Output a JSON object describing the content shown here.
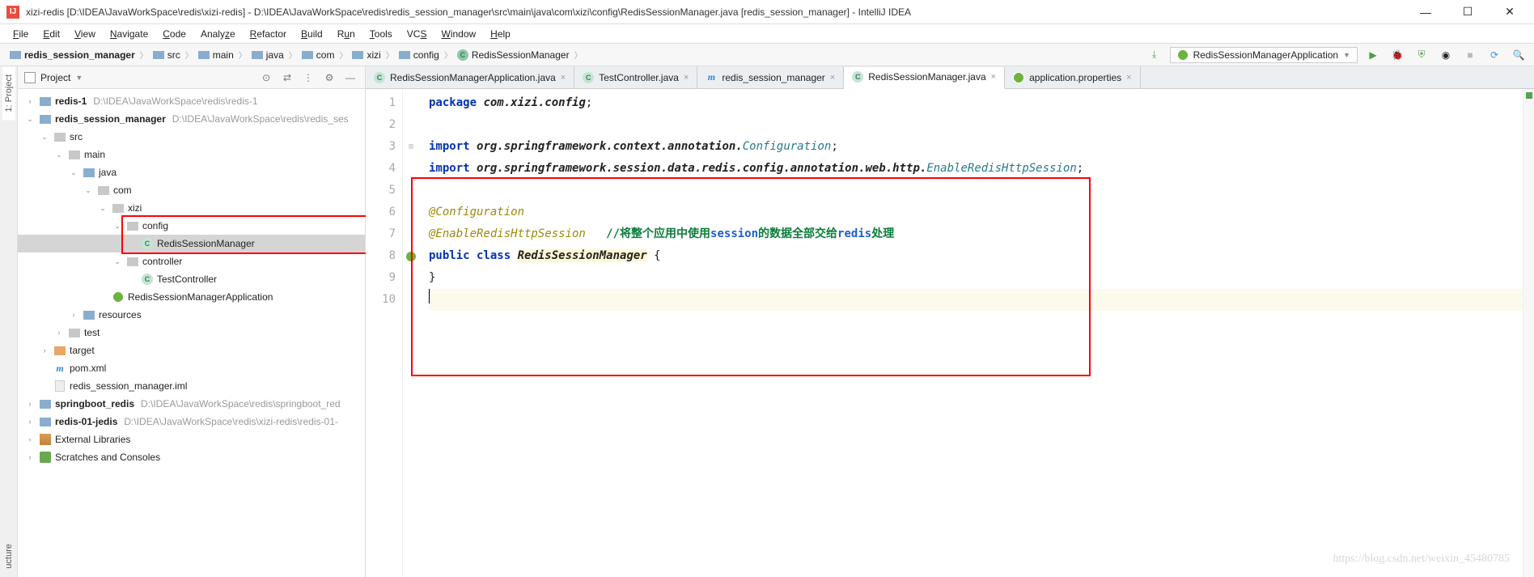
{
  "window": {
    "title": "xizi-redis [D:\\IDEA\\JavaWorkSpace\\redis\\xizi-redis] - D:\\IDEA\\JavaWorkSpace\\redis\\redis_session_manager\\src\\main\\java\\com\\xizi\\config\\RedisSessionManager.java [redis_session_manager] - IntelliJ IDEA"
  },
  "menu": [
    "File",
    "Edit",
    "View",
    "Navigate",
    "Code",
    "Analyze",
    "Refactor",
    "Build",
    "Run",
    "Tools",
    "VCS",
    "Window",
    "Help"
  ],
  "breadcrumbs": [
    {
      "icon": "module",
      "label": "redis_session_manager"
    },
    {
      "icon": "folder",
      "label": "src"
    },
    {
      "icon": "folder",
      "label": "main"
    },
    {
      "icon": "folder",
      "label": "java"
    },
    {
      "icon": "folder",
      "label": "com"
    },
    {
      "icon": "folder",
      "label": "xizi"
    },
    {
      "icon": "folder",
      "label": "config"
    },
    {
      "icon": "class",
      "label": "RedisSessionManager"
    }
  ],
  "run_config": "RedisSessionManagerApplication",
  "side_tabs": {
    "left_top": "1: Project",
    "left_bottom": "ucture"
  },
  "project_panel": {
    "title": "Project",
    "tree": [
      {
        "indent": 0,
        "exp": ">",
        "icon": "module",
        "label": "redis-1",
        "path": "D:\\IDEA\\JavaWorkSpace\\redis\\redis-1",
        "bold": true
      },
      {
        "indent": 0,
        "exp": "v",
        "icon": "module",
        "label": "redis_session_manager",
        "path": "D:\\IDEA\\JavaWorkSpace\\redis\\redis_ses",
        "bold": true
      },
      {
        "indent": 1,
        "exp": "v",
        "icon": "folder-grey",
        "label": "src"
      },
      {
        "indent": 2,
        "exp": "v",
        "icon": "folder-grey",
        "label": "main"
      },
      {
        "indent": 3,
        "exp": "v",
        "icon": "folder-blue",
        "label": "java"
      },
      {
        "indent": 4,
        "exp": "v",
        "icon": "folder-grey",
        "label": "com"
      },
      {
        "indent": 5,
        "exp": "v",
        "icon": "folder-grey",
        "label": "xizi"
      },
      {
        "indent": 6,
        "exp": "v",
        "icon": "folder-grey",
        "label": "config"
      },
      {
        "indent": 7,
        "exp": "",
        "icon": "class",
        "label": "RedisSessionManager",
        "selected": true
      },
      {
        "indent": 6,
        "exp": "v",
        "icon": "folder-grey",
        "label": "controller"
      },
      {
        "indent": 7,
        "exp": "",
        "icon": "class",
        "label": "TestController"
      },
      {
        "indent": 5,
        "exp": "",
        "icon": "spring",
        "label": "RedisSessionManagerApplication"
      },
      {
        "indent": 3,
        "exp": ">",
        "icon": "folder-blue",
        "label": "resources"
      },
      {
        "indent": 2,
        "exp": ">",
        "icon": "folder-grey",
        "label": "test"
      },
      {
        "indent": 1,
        "exp": ">",
        "icon": "folder-orange",
        "label": "target"
      },
      {
        "indent": 1,
        "exp": "",
        "icon": "maven",
        "label": "pom.xml"
      },
      {
        "indent": 1,
        "exp": "",
        "icon": "file",
        "label": "redis_session_manager.iml"
      },
      {
        "indent": 0,
        "exp": ">",
        "icon": "module",
        "label": "springboot_redis",
        "path": "D:\\IDEA\\JavaWorkSpace\\redis\\springboot_red",
        "bold": true
      },
      {
        "indent": 0,
        "exp": ">",
        "icon": "module",
        "label": "redis-01-jedis",
        "path": "D:\\IDEA\\JavaWorkSpace\\redis\\xizi-redis\\redis-01-",
        "bold": true
      },
      {
        "indent": 0,
        "exp": ">",
        "icon": "lib",
        "label": "External Libraries"
      },
      {
        "indent": 0,
        "exp": ">",
        "icon": "scratch",
        "label": "Scratches and Consoles"
      }
    ]
  },
  "editor_tabs": [
    {
      "icon": "class",
      "label": "RedisSessionManagerApplication.java",
      "active": false
    },
    {
      "icon": "class",
      "label": "TestController.java",
      "active": false
    },
    {
      "icon": "maven",
      "label": "redis_session_manager",
      "active": false
    },
    {
      "icon": "class",
      "label": "RedisSessionManager.java",
      "active": true
    },
    {
      "icon": "prop",
      "label": "application.properties",
      "active": false
    }
  ],
  "code": {
    "line_numbers": [
      "1",
      "2",
      "3",
      "4",
      "5",
      "6",
      "7",
      "8",
      "9",
      "10"
    ],
    "lines": {
      "l1_kw": "package ",
      "l1_pkg": "com.xizi.config",
      "l1_semi": ";",
      "l3_kw": "import ",
      "l3_pkg": "org.springframework.context.annotation.",
      "l3_typ": "Configuration",
      "l3_semi": ";",
      "l4_kw": "import ",
      "l4_pkg": "org.springframework.session.data.redis.config.annotation.web.http.",
      "l4_typ": "EnableRedisHttpSession",
      "l4_semi": ";",
      "l6_ann": "@Configuration",
      "l7_ann": "@EnableRedisHttpSession",
      "l7_sp": "   ",
      "l7_c1": "//将整个应用中使用",
      "l7_c2": "session",
      "l7_c3": "的数据全部交给",
      "l7_c4": "redis",
      "l7_c5": "处理",
      "l8_kw": "public class ",
      "l8_cls": "RedisSessionManager",
      "l8_br": " {",
      "l9": "}"
    }
  },
  "watermark": "https://blog.csdn.net/weixin_45480785"
}
